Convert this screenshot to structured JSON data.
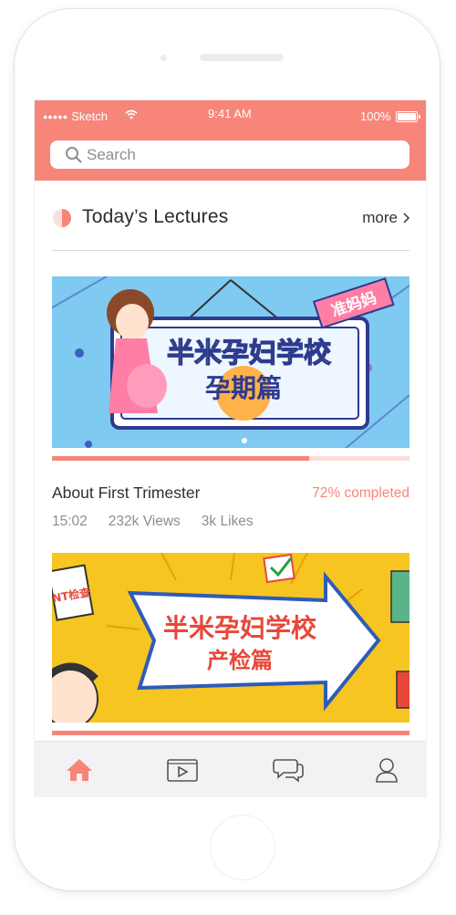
{
  "status_bar": {
    "signal_dots": "●●●●●",
    "carrier": "Sketch",
    "time": "9:41 AM",
    "battery": "100%"
  },
  "search": {
    "placeholder": "Search"
  },
  "section": {
    "title": "Today’s Lectures",
    "more_label": "more"
  },
  "lectures": [
    {
      "banner_text_line1": "半米孕妇学校",
      "banner_text_line2": "孕期篇",
      "banner_tag": "准妈妈",
      "title": "About First Trimester",
      "status": "72% completed",
      "progress": 0.72,
      "duration": "15:02",
      "views": "232k Views",
      "likes": "3k Likes"
    },
    {
      "banner_text_line1": "半米孕妇学校",
      "banner_text_line2": "产检篇",
      "banner_sign": "NT检查",
      "progress": 1.0
    }
  ],
  "tabbar": {
    "tabs": [
      "home-icon",
      "video-icon",
      "chat-icon",
      "profile-icon"
    ],
    "active": "home-icon"
  },
  "colors": {
    "accent": "#f7857a",
    "banner1_bg": "#7fcaf0",
    "banner2_bg": "#f6c521"
  }
}
